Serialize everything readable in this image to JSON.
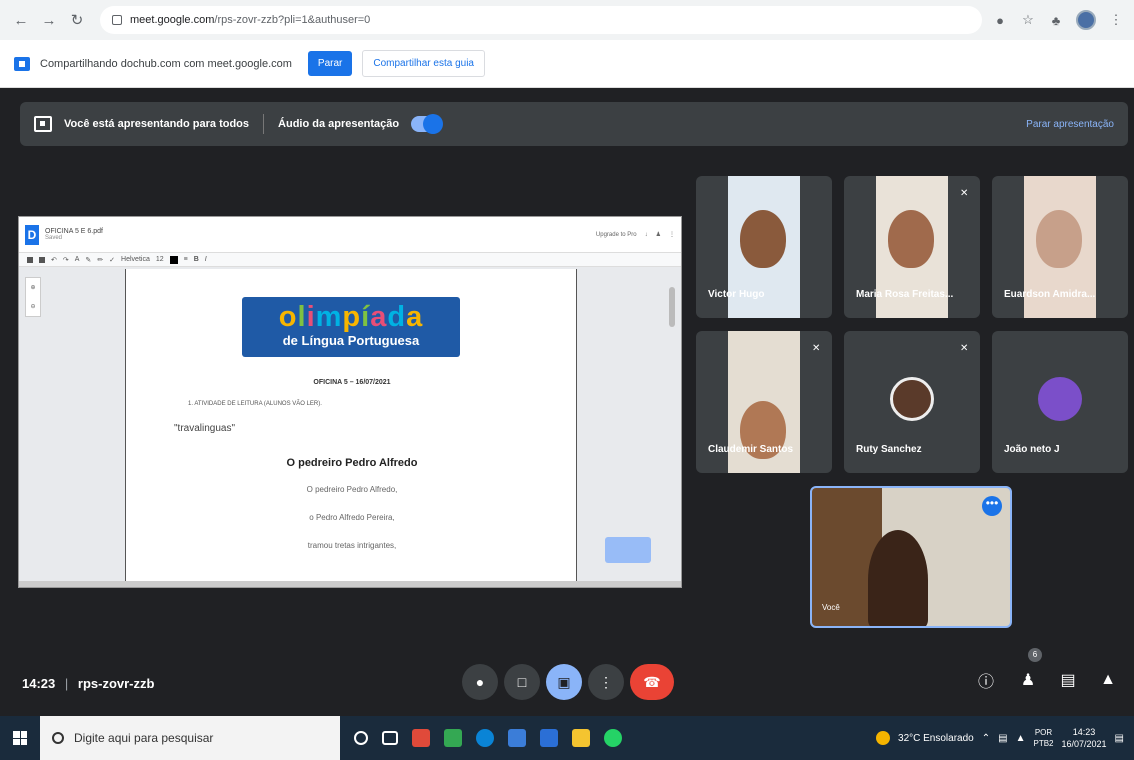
{
  "browser": {
    "url_host": "meet.google.com",
    "url_path": "/rps-zovr-zzb?pli=1&authuser=0"
  },
  "share_bar": {
    "message": "Compartilhando dochub.com com meet.google.com",
    "stop_label": "Parar",
    "share_tab_label": "Compartilhar esta guia"
  },
  "banner": {
    "presenting_text": "Você está apresentando para todos",
    "audio_label": "Áudio da apresentação",
    "stop_presenting": "Parar apresentação"
  },
  "doc": {
    "title": "OFICINA 5 E 6.pdf",
    "subtitle": "Saved",
    "upgrade": "Upgrade to Pro",
    "font": "Helvetica",
    "size": "12",
    "logo_main": "olimpíada",
    "logo_sub": "de Língua Portuguesa",
    "oficina": "OFICINA 5 – 16/07/2021",
    "atividade": "1.  ATIVIDADE DE LEITURA (ALUNOS VÃO LER).",
    "trava": "\"travalinguas\"",
    "poem_title": "O pedreiro Pedro Alfredo",
    "poem_lines": [
      "O pedreiro Pedro Alfredo,",
      "o Pedro Alfredo Pereira,",
      "tramou tretas intrigantes,"
    ]
  },
  "participants": [
    {
      "name": "Victor Hugo"
    },
    {
      "name": "Maria Rosa Freitas..."
    },
    {
      "name": "Euardson Amidra..."
    },
    {
      "name": "Claudemir Santos"
    },
    {
      "name": "Ruty Sanchez"
    },
    {
      "name": "João neto J"
    }
  ],
  "self_tile": {
    "name": "Você",
    "more": "•••"
  },
  "bottom": {
    "time": "14:23",
    "separator": "|",
    "meeting_code": "rps-zovr-zzb",
    "people_badge": "6"
  },
  "taskbar": {
    "search_placeholder": "Digite aqui para pesquisar",
    "weather": "32°C  Ensolarado",
    "lang_top": "POR",
    "lang_bottom": "PTB2",
    "time": "14:23",
    "date": "16/07/2021"
  },
  "colors": {
    "accent": "#1a73e8",
    "danger": "#ea4335",
    "meet_bg": "#202124"
  }
}
